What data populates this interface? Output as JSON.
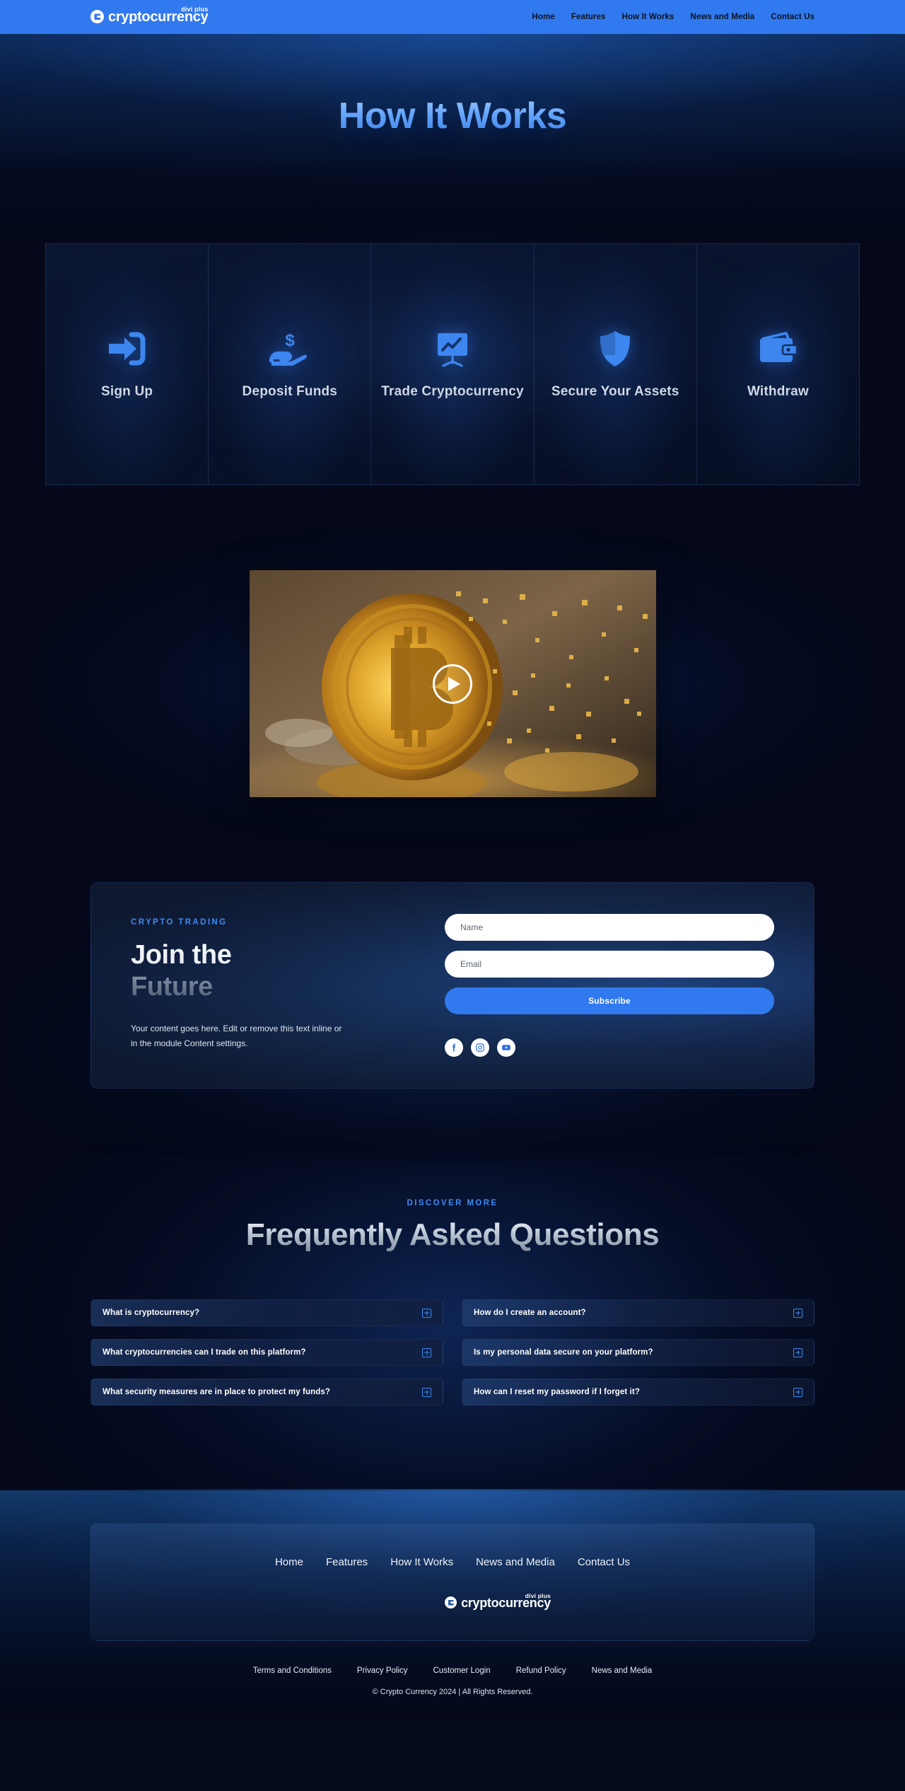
{
  "header": {
    "brand": {
      "name": "cryptocurrency",
      "sup": "divi plus",
      "logo_icon": "crypto-coin-icon"
    },
    "nav": [
      {
        "label": "Home"
      },
      {
        "label": "Features"
      },
      {
        "label": "How It Works"
      },
      {
        "label": "News and Media"
      },
      {
        "label": "Contact Us"
      }
    ]
  },
  "hero": {
    "title": "How It Works"
  },
  "steps": [
    {
      "label": "Sign Up",
      "icon": "sign-in-arrow-icon"
    },
    {
      "label": "Deposit Funds",
      "icon": "hand-holding-dollar-icon"
    },
    {
      "label": "Trade Cryptocurrency",
      "icon": "chart-presentation-icon"
    },
    {
      "label": "Secure Your Assets",
      "icon": "shield-icon"
    },
    {
      "label": "Withdraw",
      "icon": "wallet-icon"
    }
  ],
  "video": {
    "play_label": "Play",
    "icon": "play-icon",
    "alt": "Bitcoin coin disintegrating into gold particles"
  },
  "subscribe": {
    "eyebrow": "CRYPTO TRADING",
    "heading_line1": "Join the",
    "heading_line2": "Future",
    "copy": "Your content goes here. Edit or remove this text inline or in the module Content settings.",
    "name_placeholder": "Name",
    "email_placeholder": "Email",
    "button_label": "Subscribe",
    "socials": [
      {
        "name": "facebook-icon",
        "label": "Facebook"
      },
      {
        "name": "instagram-icon",
        "label": "Instagram"
      },
      {
        "name": "youtube-icon",
        "label": "YouTube"
      }
    ]
  },
  "faq": {
    "eyebrow": "DISCOVER MORE",
    "title": "Frequently Asked Questions",
    "items": [
      {
        "question": "What is cryptocurrency?"
      },
      {
        "question": "How do I create an account?"
      },
      {
        "question": "What cryptocurrencies can I trade on this platform?"
      },
      {
        "question": "Is my personal data secure on your platform?"
      },
      {
        "question": "What security measures are in place to protect my funds?"
      },
      {
        "question": "How can I reset my password if I forget it?"
      }
    ]
  },
  "footer": {
    "nav": [
      {
        "label": "Home"
      },
      {
        "label": "Features"
      },
      {
        "label": "How It Works"
      },
      {
        "label": "News and Media"
      },
      {
        "label": "Contact Us"
      }
    ],
    "brand": {
      "name": "cryptocurrency",
      "sup": "divi plus"
    },
    "links": [
      {
        "label": "Terms and Conditions"
      },
      {
        "label": "Privacy Policy"
      },
      {
        "label": "Customer Login"
      },
      {
        "label": "Refund Policy"
      },
      {
        "label": "News and Media"
      }
    ],
    "copyright": "© Crypto Currency 2024 | All Rights Reserved."
  },
  "colors": {
    "accent": "#3179ee",
    "accent_light": "#3f8bf2",
    "page_bg": "#04081a",
    "header_bg": "#3179ee"
  }
}
